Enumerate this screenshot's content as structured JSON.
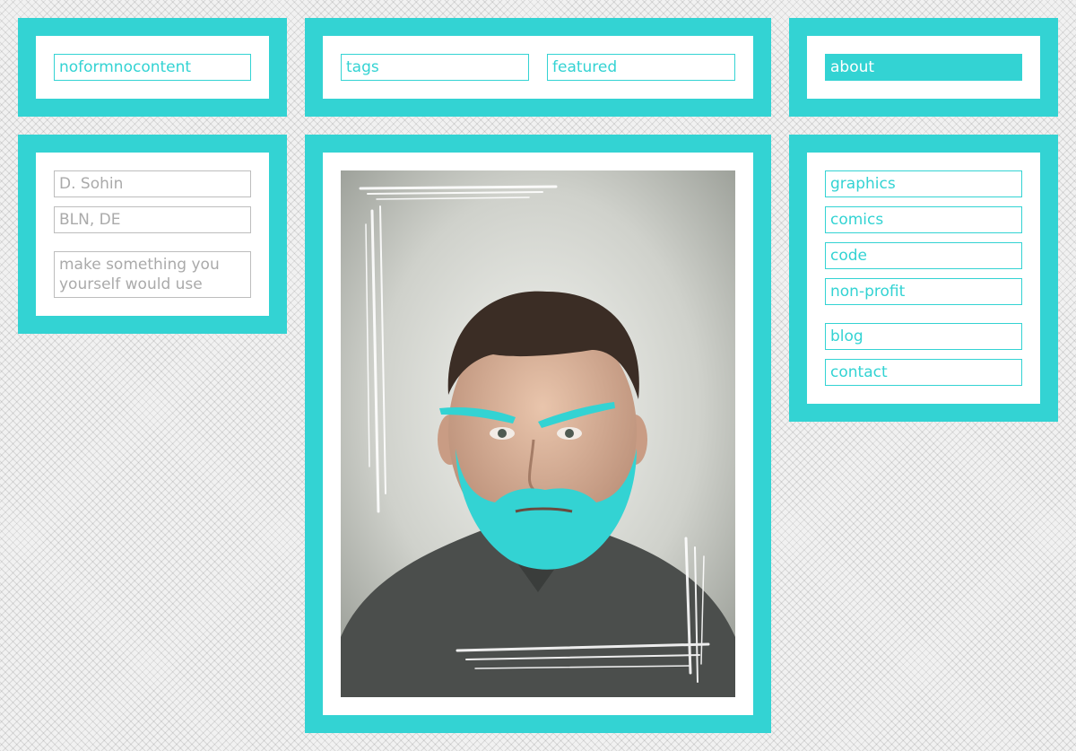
{
  "header": {
    "logo_text": "noformnocontent",
    "tabs": [
      {
        "label": "tags"
      },
      {
        "label": "featured"
      }
    ],
    "about_label": "about"
  },
  "profile": {
    "name": "D. Sohin",
    "location": "BLN, DE",
    "motto": "make something you yourself would use"
  },
  "sidebar": {
    "items": [
      {
        "label": "graphics"
      },
      {
        "label": "comics"
      },
      {
        "label": "code"
      },
      {
        "label": "non-profit"
      },
      {
        "label": "blog"
      },
      {
        "label": "contact"
      }
    ]
  },
  "colors": {
    "accent": "#33d3d3",
    "panel": "#ffffff",
    "muted_text": "#aaaaaa"
  }
}
